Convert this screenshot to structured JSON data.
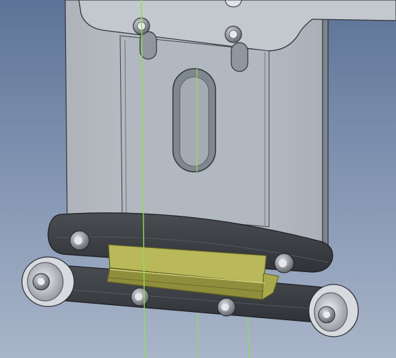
{
  "viewport": {
    "kind": "3D CAD model view",
    "colors": {
      "background_top": "#5d7397",
      "background_bottom": "#a9b5c9",
      "plate": "#b7bcc3",
      "plate_edge": "#30343a",
      "arm": "#3c3f44",
      "pad": "#b7b655",
      "axis_line": "#8fe04a"
    }
  },
  "parts": {
    "mounting_plate": {
      "label": ""
    },
    "upper_arm": {
      "label": ""
    },
    "lower_arm": {
      "label": ""
    },
    "pad_block": {
      "label": ""
    },
    "rollers": {
      "count": 2
    },
    "bolts": {
      "count": 9
    }
  }
}
